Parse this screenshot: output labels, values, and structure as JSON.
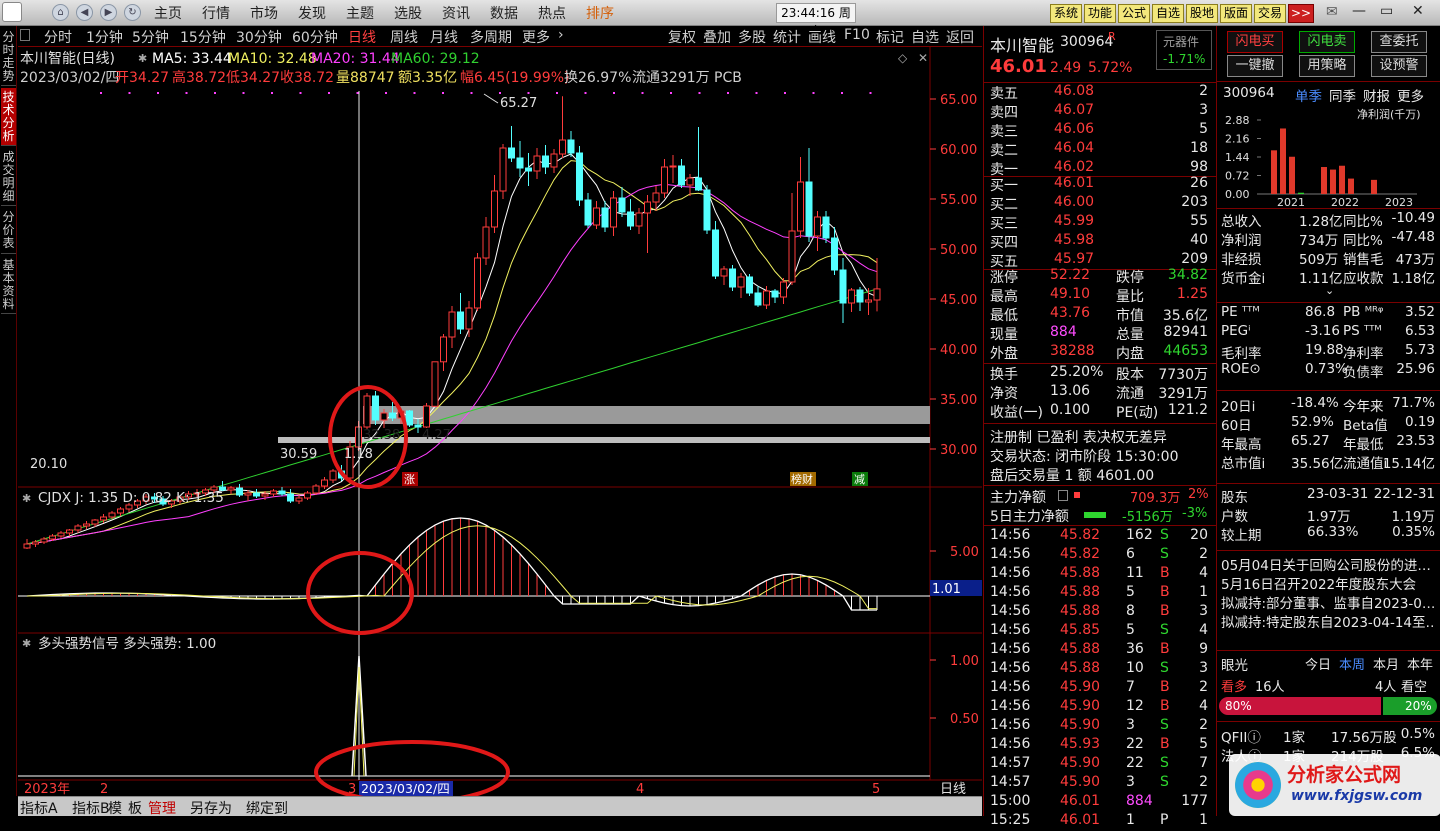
{
  "topbar": {
    "menus": [
      "主页",
      "行情",
      "市场",
      "发现",
      "主题",
      "选股",
      "资讯",
      "数据",
      "热点",
      "排序"
    ],
    "clock": "23:44:16 周六",
    "buttons": [
      "系统",
      "功能",
      "公式",
      "自选",
      "股地",
      "版面",
      "交易",
      ">>"
    ],
    "window": [
      "—",
      "▭",
      "✕"
    ]
  },
  "lefttabs": [
    "分时走势",
    "技术分析",
    "成交明细",
    "分价表",
    "基本资料"
  ],
  "periodbar": {
    "items": [
      "分时",
      "1分钟",
      "5分钟",
      "15分钟",
      "30分钟",
      "60分钟",
      "日线",
      "周线",
      "月线",
      "多周期",
      "更多"
    ],
    "active": "日线",
    "tools": [
      "复权",
      "叠加",
      "多股",
      "统计",
      "画线",
      "F10",
      "标记",
      "自选",
      "返回"
    ]
  },
  "kline": {
    "name": "本川智能(日线)",
    "ma5": "MA5: 33.44",
    "ma10": "MA10: 32.48",
    "ma20": "MA20: 31.44",
    "ma60": "MA60: 29.12",
    "date": "2023/03/02/四",
    "open_l": "开",
    "open": "34.27",
    "high_l": "高",
    "high": "38.72",
    "low_l": "低",
    "low": "34.27",
    "close_l": "收",
    "close": "38.72",
    "vol": "量88747",
    "amt": "额3.35亿",
    "chg_l": "幅",
    "chg": "6.45(19.99%)",
    "turn": "换26.97%",
    "float": "流通3291万",
    "ind": "PCB",
    "yticks": [
      "65.00",
      "60.00",
      "55.00",
      "50.00",
      "45.00",
      "40.00",
      "35.00",
      "30.00"
    ],
    "highlabel": "65.27",
    "lowlabel": "20.10",
    "lbl1": "32.38",
    "lbl2": "4.27",
    "lbl3": "30.59",
    "lbl4": "1.18",
    "tag_zhang": "涨",
    "tag_bang": "榜财",
    "tag_jian": "减"
  },
  "candles": [
    [
      20.1,
      21,
      20,
      20.5
    ],
    [
      20.5,
      20.9,
      20.2,
      20.7
    ],
    [
      20.7,
      21.2,
      20.5,
      21
    ],
    [
      21,
      21.5,
      20.8,
      21.3
    ],
    [
      21.3,
      21.8,
      21.1,
      21.6
    ],
    [
      21.6,
      22,
      21.3,
      21.9
    ],
    [
      21.9,
      22.5,
      21.6,
      22.3
    ],
    [
      22.3,
      22.8,
      22,
      22.5
    ],
    [
      22.5,
      23,
      22.2,
      22.9
    ],
    [
      22.9,
      23.5,
      22.6,
      23.2
    ],
    [
      23.2,
      23.8,
      23,
      23.6
    ],
    [
      23.6,
      24.2,
      23.3,
      24
    ],
    [
      24,
      24.6,
      23.7,
      24.4
    ],
    [
      24.4,
      25,
      24.1,
      24.8
    ],
    [
      24.8,
      25.5,
      24.5,
      25.2
    ],
    [
      25.2,
      25.6,
      24.6,
      25
    ],
    [
      25,
      25.3,
      24.3,
      24.5
    ],
    [
      24.5,
      25,
      24.1,
      24.8
    ],
    [
      24.8,
      25.4,
      24.5,
      25.2
    ],
    [
      25.2,
      25.8,
      24.9,
      25.5
    ],
    [
      25.5,
      26,
      25.2,
      25.6
    ],
    [
      25.6,
      26.1,
      25.3,
      25.9
    ],
    [
      25.9,
      26.4,
      25.6,
      26.2
    ],
    [
      26.2,
      26.8,
      25.8,
      25.9
    ],
    [
      25.9,
      26.3,
      25.5,
      26.1
    ],
    [
      26.1,
      26.5,
      25.2,
      25.4
    ],
    [
      25.4,
      25.9,
      24.8,
      25.6
    ],
    [
      25.6,
      26,
      25.1,
      25.3
    ],
    [
      25.3,
      25.8,
      24.9,
      25.5
    ],
    [
      25.5,
      26,
      25.2,
      25.8
    ],
    [
      25.8,
      26.2,
      25.3,
      25.5
    ],
    [
      25.5,
      26,
      24.6,
      24.8
    ],
    [
      24.8,
      25.4,
      24.5,
      25.1
    ],
    [
      25.1,
      25.8,
      24.9,
      25.6
    ],
    [
      25.6,
      26.5,
      25.4,
      26.3
    ],
    [
      26.3,
      27.2,
      26,
      26.9
    ],
    [
      26.9,
      28,
      26.6,
      27.8
    ],
    [
      27.8,
      28.4,
      26.8,
      27.1
    ],
    [
      27.1,
      30.8,
      27,
      30.2
    ],
    [
      30.2,
      32.8,
      29.8,
      32.2
    ],
    [
      32.2,
      35.6,
      32,
      35.3
    ],
    [
      35.3,
      35.8,
      32.4,
      32.9
    ],
    [
      32.9,
      34,
      32.1,
      33.6
    ],
    [
      33.6,
      34.7,
      32.8,
      33.1
    ],
    [
      33.1,
      34,
      32.5,
      33.8
    ],
    [
      33.8,
      33.9,
      32.2,
      32.4
    ],
    [
      32.4,
      33,
      31.6,
      32.2
    ],
    [
      32.2,
      34.6,
      32.1,
      34.3
    ],
    [
      34.27,
      38.72,
      34.27,
      38.72
    ],
    [
      38.72,
      41.5,
      37.8,
      41.2
    ],
    [
      41.2,
      44.3,
      40.1,
      43.7
    ],
    [
      43.7,
      45.6,
      41.5,
      42
    ],
    [
      42,
      44.8,
      41.2,
      44.1
    ],
    [
      44.1,
      49.6,
      43.8,
      49.1
    ],
    [
      49.1,
      53.2,
      48.4,
      52.2
    ],
    [
      52.2,
      57.4,
      51.6,
      55.8
    ],
    [
      55.8,
      60.5,
      55,
      60.1
    ],
    [
      60.1,
      62.3,
      58.7,
      59.1
    ],
    [
      59.1,
      60.8,
      57.2,
      58.1
    ],
    [
      58.1,
      59.6,
      56.3,
      57.8
    ],
    [
      57.8,
      60.1,
      57,
      59.3
    ],
    [
      59.3,
      60.4,
      57.5,
      58.2
    ],
    [
      58.2,
      60,
      57.6,
      59.5
    ],
    [
      59.5,
      65.27,
      59.1,
      60.9
    ],
    [
      60.9,
      61.8,
      59.2,
      59.6
    ],
    [
      59.6,
      60.3,
      54.3,
      54.9
    ],
    [
      54.9,
      55.6,
      52.1,
      52.4
    ],
    [
      52.4,
      54.8,
      52,
      54.1
    ],
    [
      54.1,
      54.8,
      51.7,
      52.2
    ],
    [
      52.2,
      55.8,
      51.3,
      55.1
    ],
    [
      55.1,
      56.2,
      53.2,
      53.7
    ],
    [
      53.7,
      55,
      51.9,
      52.3
    ],
    [
      52.3,
      54.1,
      51.5,
      53.6
    ],
    [
      53.6,
      55.4,
      49.6,
      54.7
    ],
    [
      54.7,
      56.3,
      53.8,
      55.6
    ],
    [
      55.6,
      59,
      55.1,
      58.2
    ],
    [
      58.2,
      59.4,
      56.6,
      58.3
    ],
    [
      58.3,
      59,
      56.1,
      56.4
    ],
    [
      56.4,
      57.5,
      55.3,
      57.1
    ],
    [
      57.1,
      62.2,
      55.8,
      55.9
    ],
    [
      55.9,
      56.4,
      51.5,
      51.9
    ],
    [
      51.9,
      52.8,
      47,
      47.3
    ],
    [
      47.3,
      48.3,
      46.4,
      48
    ],
    [
      48,
      48.4,
      45.8,
      46.2
    ],
    [
      46.2,
      47.6,
      45.1,
      47.2
    ],
    [
      47.2,
      47.5,
      45.3,
      45.6
    ],
    [
      45.6,
      46.3,
      44.2,
      44.4
    ],
    [
      44.4,
      46.3,
      44,
      45.8
    ],
    [
      45.8,
      46,
      44.6,
      45.2
    ],
    [
      45.2,
      47.1,
      44.5,
      46.7
    ],
    [
      46.7,
      55.6,
      46.4,
      51.8
    ],
    [
      51.8,
      59.2,
      51.1,
      56.7
    ],
    [
      56.7,
      60.1,
      50.7,
      51.3
    ],
    [
      51.3,
      53.8,
      49.8,
      53.2
    ],
    [
      53.2,
      53.8,
      50.6,
      51.1
    ],
    [
      51.1,
      52.2,
      47.4,
      47.9
    ],
    [
      47.9,
      49.1,
      42.6,
      44.6
    ],
    [
      44.6,
      46.1,
      43.7,
      45.9
    ],
    [
      45.9,
      46.2,
      43.8,
      44.7
    ],
    [
      44.7,
      46.1,
      43.4,
      44.9
    ],
    [
      44.9,
      49.1,
      43.76,
      46.01
    ]
  ],
  "cjdx": {
    "title": "CJDX J: 1.35  D: 0.82  K: 1.35",
    "ytick": "5.00",
    "cur": "1.01"
  },
  "signal": {
    "title": "多头强势信号  多头强势: 1.00",
    "y1": "1.00",
    "y2": "0.50"
  },
  "xaxis": {
    "labels": [
      "2023年",
      "2",
      "3",
      "4",
      "5"
    ],
    "date": "2023/03/02/四",
    "period": "日线"
  },
  "bottombar": [
    "指标A",
    "指标B",
    "模",
    "板",
    "管理",
    "另存为",
    "绑定到"
  ],
  "quote": {
    "name": "本川智能",
    "code": "300964",
    "tag": "R",
    "block": "元器件",
    "blockchg": "-1.71%",
    "price": "46.01",
    "chg": "2.49",
    "pct": "5.72%",
    "asks": [
      [
        "卖五",
        "46.08",
        "2"
      ],
      [
        "卖四",
        "46.07",
        "3"
      ],
      [
        "卖三",
        "46.06",
        "5"
      ],
      [
        "卖二",
        "46.04",
        "18"
      ],
      [
        "卖一",
        "46.02",
        "98"
      ]
    ],
    "bids": [
      [
        "买一",
        "46.01",
        "26"
      ],
      [
        "买二",
        "46.00",
        "203"
      ],
      [
        "买三",
        "45.99",
        "55"
      ],
      [
        "买四",
        "45.98",
        "40"
      ],
      [
        "买五",
        "45.97",
        "209"
      ]
    ],
    "stats": [
      [
        "涨停",
        "52.22",
        "跌停",
        "34.82"
      ],
      [
        "最高",
        "49.10",
        "量比",
        "1.25"
      ],
      [
        "最低",
        "43.76",
        "市值",
        "35.6亿"
      ],
      [
        "现量",
        "884",
        "总量",
        "82941"
      ],
      [
        "外盘",
        "38288",
        "内盘",
        "44653"
      ]
    ],
    "stats2": [
      [
        "换手",
        "25.20%",
        "股本",
        "7730万"
      ],
      [
        "净资",
        "13.06",
        "流通",
        "3291万"
      ],
      [
        "收益(一)",
        "0.100",
        "PE(动)",
        "121.2"
      ]
    ],
    "reg": "注册制 已盈利 表决权无差异",
    "status": "交易状态: 闭市阶段 15:30:00",
    "after": "盘后交易量 1 额 4601.00",
    "flow1_l": "主力净额",
    "flow1": "709.3万",
    "flow1p": "2%",
    "flow2_l": "5日主力净额",
    "flow2": "-5156万",
    "flow2p": "-3%",
    "ticks": [
      [
        "14:56",
        "45.82",
        "162",
        "S",
        "20"
      ],
      [
        "14:56",
        "45.82",
        "6",
        "S",
        "2"
      ],
      [
        "14:56",
        "45.88",
        "11",
        "B",
        "4"
      ],
      [
        "14:56",
        "45.88",
        "5",
        "B",
        "1"
      ],
      [
        "14:56",
        "45.88",
        "8",
        "B",
        "3"
      ],
      [
        "14:56",
        "45.85",
        "5",
        "S",
        "4"
      ],
      [
        "14:56",
        "45.88",
        "36",
        "B",
        "9"
      ],
      [
        "14:56",
        "45.88",
        "10",
        "S",
        "3"
      ],
      [
        "14:56",
        "45.90",
        "7",
        "B",
        "2"
      ],
      [
        "14:56",
        "45.90",
        "12",
        "B",
        "4"
      ],
      [
        "14:56",
        "45.90",
        "3",
        "S",
        "2"
      ],
      [
        "14:56",
        "45.93",
        "22",
        "B",
        "5"
      ],
      [
        "14:57",
        "45.90",
        "22",
        "S",
        "7"
      ],
      [
        "14:57",
        "45.90",
        "3",
        "S",
        "2"
      ],
      [
        "15:00",
        "46.01",
        "884",
        "",
        "177"
      ],
      [
        "15:25",
        "46.01",
        "1",
        "P",
        "1"
      ]
    ]
  },
  "f10": {
    "buttons": [
      "闪电买",
      "闪电卖",
      "查委托",
      "一键撤",
      "用策略",
      "设预警"
    ],
    "code": "300964",
    "tabs": [
      "单季",
      "同季",
      "财报",
      "更多"
    ],
    "unit": "净利润(千万)",
    "ybars": [
      "2.88",
      "2.16",
      "1.44",
      "0.72",
      "0.00"
    ],
    "years": [
      "2021",
      "2022",
      "2023"
    ],
    "bars": [
      [
        1.7,
        2.55,
        1.45,
        0.05
      ],
      [
        1.05,
        0.95,
        1.1,
        0.6
      ],
      [
        0.55
      ]
    ],
    "fin": [
      [
        "总收入",
        "1.28亿",
        "同比%",
        "-10.49"
      ],
      [
        "净利润",
        "734万",
        "同比%",
        "-47.48"
      ],
      [
        "非经损",
        "509万",
        "销售毛",
        "473万"
      ],
      [
        "货币金i",
        "1.11亿",
        "应收款",
        "1.18亿"
      ]
    ],
    "val": [
      [
        "PE ᵀᵀᴹ",
        "86.8",
        "PB ᴹᴿᵠ",
        "3.52"
      ],
      [
        "PEGⁱ",
        "-3.16",
        "PS ᵀᵀᴹ",
        "6.53"
      ],
      [
        "毛利率",
        "19.88",
        "净利率",
        "5.73"
      ],
      [
        "ROE⊙",
        "0.73%",
        "负债率",
        "25.96"
      ]
    ],
    "perf": [
      [
        "20日i",
        "-18.4%",
        "今年来",
        "71.7%"
      ],
      [
        "60日",
        "52.9%",
        "Beta值",
        "0.19"
      ],
      [
        "年最高",
        "65.27",
        "年最低",
        "23.53"
      ],
      [
        "总市值i",
        "35.56亿",
        "流通值i",
        "15.14亿"
      ]
    ],
    "holder": [
      [
        "股东",
        "23-03-31",
        "22-12-31"
      ],
      [
        "户数",
        "1.97万",
        "1.19万"
      ],
      [
        "较上期",
        "66.33%",
        "0.35%"
      ]
    ],
    "news": [
      "05月04日关于回购公司股份的进…",
      "5月16日召开2022年度股东大会",
      "拟减持:部分董事、监事自2023-0…",
      "拟减持:特定股东自2023-04-14至…"
    ],
    "view": {
      "title": "眼光",
      "tabs": [
        "今日",
        "本周",
        "本月",
        "本年"
      ],
      "kanduo": "看多",
      "kd_n": "16人",
      "kankong": "看空",
      "kk_n": "4人",
      "pct_up": "80%",
      "pct_dn": "20%"
    },
    "inst": [
      [
        "QFIIⓘ",
        "1家",
        "17.56万股",
        "0.5%"
      ],
      [
        "法人ⓘ",
        "1家",
        "214万股",
        "6.5%"
      ]
    ],
    "watermark": "分析家公式网",
    "watermark_url": "www.fxjgsw.com"
  },
  "colors": {
    "up": "#ff3c3c",
    "down": "#54ffff",
    "ma5": "#ffffff",
    "ma10": "#f0f060",
    "ma20": "#ff40ff",
    "ma60": "#30d030",
    "annot": "#e01818"
  }
}
